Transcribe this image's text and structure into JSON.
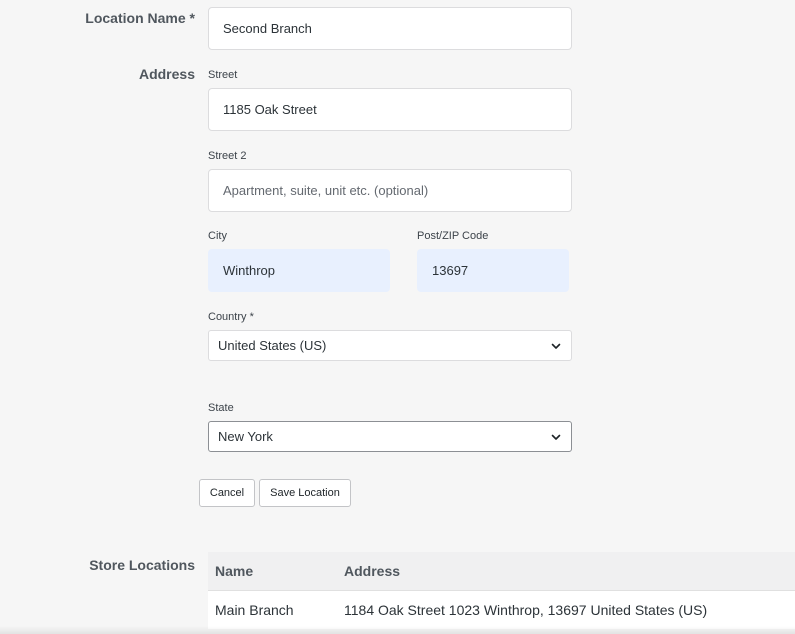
{
  "form": {
    "location_name_label": "Location Name *",
    "location_name_value": "Second Branch",
    "address_label": "Address",
    "street_label": "Street",
    "street_value": "1185 Oak Street",
    "street2_label": "Street 2",
    "street2_placeholder": "Apartment, suite, unit etc. (optional)",
    "city_label": "City",
    "city_value": "Winthrop",
    "zip_label": "Post/ZIP Code",
    "zip_value": "13697",
    "country_label": "Country *",
    "country_value": "United States (US)",
    "state_label": "State",
    "state_value": "New York",
    "cancel_label": "Cancel",
    "save_label": "Save Location"
  },
  "store_locations": {
    "label": "Store Locations",
    "columns": [
      "Name",
      "Address"
    ],
    "rows": [
      {
        "name": "Main Branch",
        "address": "1184 Oak Street 1023 Winthrop, 13697 United States (US)"
      }
    ]
  },
  "icons": {
    "select_chevron": "chevron-down-icon"
  },
  "colors": {
    "autofill_bg": "#e8f0fe",
    "page_bg": "#f6f6f6"
  }
}
